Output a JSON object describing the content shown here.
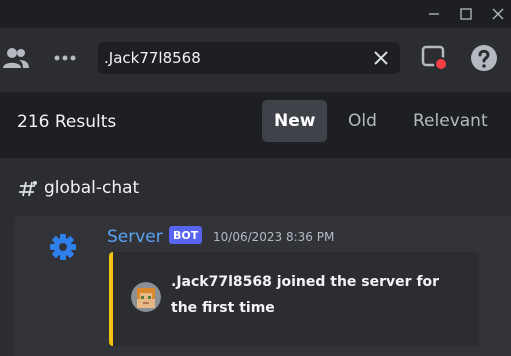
{
  "toolbar": {
    "search_value": ".Jack77l8568"
  },
  "results": {
    "count_label": "216 Results",
    "sort_tabs": [
      "New",
      "Old",
      "Relevant"
    ],
    "selected_sort": "New"
  },
  "channel": {
    "name": "global-chat"
  },
  "message": {
    "author": "Server",
    "badge": "BOT",
    "timestamp": "10/06/2023 8:36 PM",
    "embed_text": ".Jack77l8568 joined the server for the first time",
    "embed_accent": "#f1c40f"
  },
  "icons": {
    "window": [
      "minimize-icon",
      "maximize-icon",
      "close-icon"
    ],
    "toolbar": [
      "members-icon",
      "more-icon",
      "clear-search-icon",
      "inbox-icon",
      "help-icon"
    ],
    "channel": "text-channel-icon",
    "author": "gear-icon"
  },
  "colors": {
    "author": "#5aa4f5",
    "bot_badge": "#5865f2",
    "notification_dot": "#f23f43"
  }
}
